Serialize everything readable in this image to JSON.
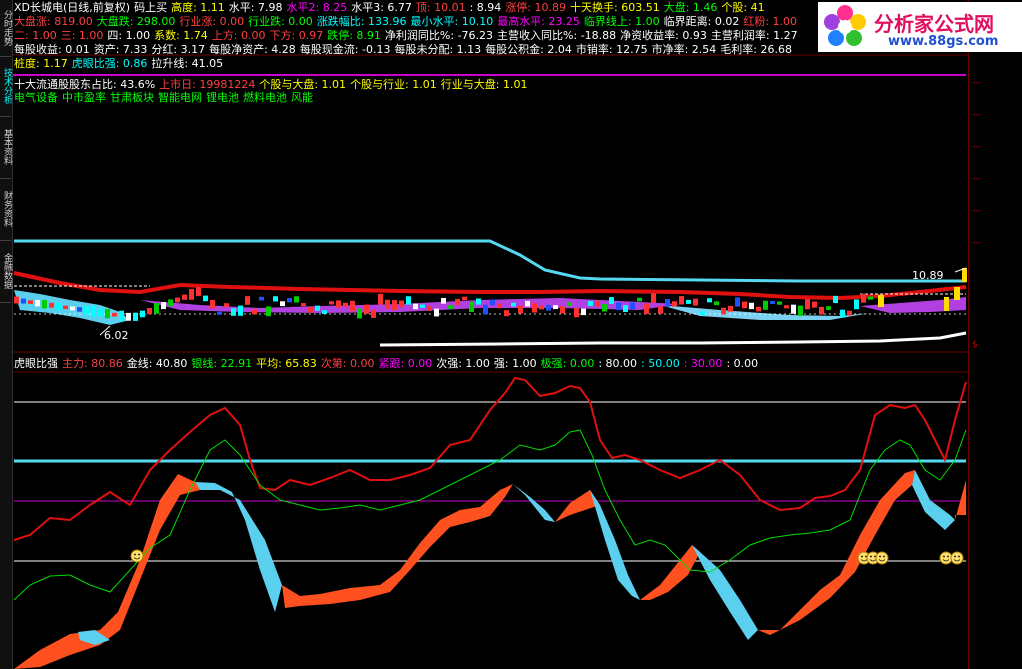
{
  "sidebar": {
    "tabs": [
      {
        "label": "分时走势"
      },
      {
        "label": "技术分析"
      },
      {
        "label": "基本资料"
      },
      {
        "label": "财务资料"
      },
      {
        "label": "金融数据"
      }
    ]
  },
  "logo": {
    "text": "分析家公式网",
    "url_text": "www.88gs.com"
  },
  "header": {
    "row1": [
      {
        "text": "XD长城电(日线,前复权)",
        "color": "#ffffff"
      },
      {
        "text": "码上买",
        "color": "#ffffff"
      },
      {
        "text": "高度: 1.11",
        "color": "#ffff00"
      },
      {
        "text": "水平: 7.98",
        "color": "#ffffff"
      },
      {
        "text": "水平2: 8.25",
        "color": "#ff00ff"
      },
      {
        "text": "水平3: 6.77",
        "color": "#ffffff"
      },
      {
        "text": "顶: 10.01",
        "color": "#ff4040"
      },
      {
        "text": ": 8.94",
        "color": "#ffffff"
      },
      {
        "text": "涨停: 10.89",
        "color": "#ff4040"
      },
      {
        "text": "十天换手: 603.51",
        "color": "#ffff00"
      },
      {
        "text": "大盘: 1.46",
        "color": "#00ff00"
      },
      {
        "text": "个股: 41",
        "color": "#ffff00"
      }
    ],
    "row2": [
      {
        "text": "大盘涨: 819.00",
        "color": "#ff4040"
      },
      {
        "text": "大盘跌: 298.00",
        "color": "#00ff00"
      },
      {
        "text": "行业涨: 0.00",
        "color": "#ff4040"
      },
      {
        "text": "行业跌: 0.00",
        "color": "#00ff00"
      },
      {
        "text": "涨跌幅比: 133.96",
        "color": "#00ffff"
      },
      {
        "text": "最小水平: 10.10",
        "color": "#00ffff"
      },
      {
        "text": "最高水平: 23.25",
        "color": "#ff00ff"
      },
      {
        "text": "临界线上: 1.00",
        "color": "#00ff00"
      },
      {
        "text": "临界距离: 0.02",
        "color": "#ffffff"
      },
      {
        "text": "红粉: 1.00",
        "color": "#ff4040"
      }
    ],
    "row3": [
      {
        "text": "二: 1.00",
        "color": "#ff4040"
      },
      {
        "text": "三: 1.00",
        "color": "#ff4040"
      },
      {
        "text": "四: 1.00",
        "color": "#ffffff"
      },
      {
        "text": "系数: 1.74",
        "color": "#ffff00"
      },
      {
        "text": "上方: 0.00",
        "color": "#ff4040"
      },
      {
        "text": "下方: 0.97",
        "color": "#ff4040"
      },
      {
        "text": "跌停: 8.91",
        "color": "#00ff00"
      },
      {
        "text": "净利润同比%: -76.23",
        "color": "#ffffff"
      },
      {
        "text": "主营收入同比%: -18.88",
        "color": "#ffffff"
      },
      {
        "text": "净资收益率: 0.93",
        "color": "#ffffff"
      },
      {
        "text": "主营利润率: 1.27",
        "color": "#ffffff"
      }
    ],
    "row4": [
      {
        "text": "每股收益: 0.01",
        "color": "#ffffff"
      },
      {
        "text": "资产: 7.33",
        "color": "#ffffff"
      },
      {
        "text": "分红: 3.17",
        "color": "#ffffff"
      },
      {
        "text": "每股净资产: 4.28",
        "color": "#ffffff"
      },
      {
        "text": "每股现金流: -0.13",
        "color": "#ffffff"
      },
      {
        "text": "每股未分配: 1.13",
        "color": "#ffffff"
      },
      {
        "text": "每股公积金: 2.04",
        "color": "#ffffff"
      },
      {
        "text": "市销率: 12.75",
        "color": "#ffffff"
      },
      {
        "text": "市净率: 2.54",
        "color": "#ffffff"
      },
      {
        "text": "毛利率: 26.68",
        "color": "#ffffff"
      }
    ],
    "row5": [
      {
        "text": "桩度: 1.17",
        "color": "#ffff00"
      },
      {
        "text": "虎眼比强: 0.86",
        "color": "#00ffff"
      },
      {
        "text": "拉升线: 41.05",
        "color": "#ffffff"
      }
    ],
    "row6": [
      {
        "text": "十大流通股股东占比: 43.6%",
        "color": "#ffffff"
      },
      {
        "text": "上市日: 19981224",
        "color": "#ff4040"
      },
      {
        "text": "个股与大盘: 1.01",
        "color": "#ffff00"
      },
      {
        "text": "个股与行业: 1.01",
        "color": "#ffff00"
      },
      {
        "text": "行业与大盘: 1.01",
        "color": "#ffff00"
      }
    ],
    "row7": [
      {
        "text": "电气设备",
        "color": "#00ff00"
      },
      {
        "text": "中市盈率",
        "color": "#00ff00"
      },
      {
        "text": "甘肃板块",
        "color": "#00ff00"
      },
      {
        "text": "智能电网",
        "color": "#00ff00"
      },
      {
        "text": "锂电池",
        "color": "#00ff00"
      },
      {
        "text": "燃料电池",
        "color": "#00ff00"
      },
      {
        "text": "风能",
        "color": "#00ff00"
      }
    ]
  },
  "main_chart": {
    "price_high_label": "10.89",
    "price_low_label": "6.02"
  },
  "indicator": {
    "legend": [
      {
        "text": "虎眼比强",
        "color": "#ffffff"
      },
      {
        "text": "主力: 80.86",
        "color": "#ff4040"
      },
      {
        "text": "金线: 40.80",
        "color": "#ffffff"
      },
      {
        "text": "银线: 22.91",
        "color": "#00ff00"
      },
      {
        "text": "平均: 65.83",
        "color": "#ffff00"
      },
      {
        "text": "次第: 0.00",
        "color": "#ff4040"
      },
      {
        "text": "紧跟: 0.00",
        "color": "#ff00ff"
      },
      {
        "text": "次强: 1.00",
        "color": "#ffffff"
      },
      {
        "text": "强: 1.00",
        "color": "#ffffff"
      },
      {
        "text": "极强: 0.00",
        "color": "#00ff00"
      },
      {
        "text": ": 80.00",
        "color": "#ffffff"
      },
      {
        "text": ": 50.00",
        "color": "#00ffff"
      },
      {
        "text": ": 30.00",
        "color": "#ff00ff"
      },
      {
        "text": ": 0.00",
        "color": "#ffffff"
      }
    ]
  },
  "colors": {
    "background": "#000000",
    "up": "#ff3030",
    "down": "#00ffff",
    "axis": "#aa0000"
  }
}
